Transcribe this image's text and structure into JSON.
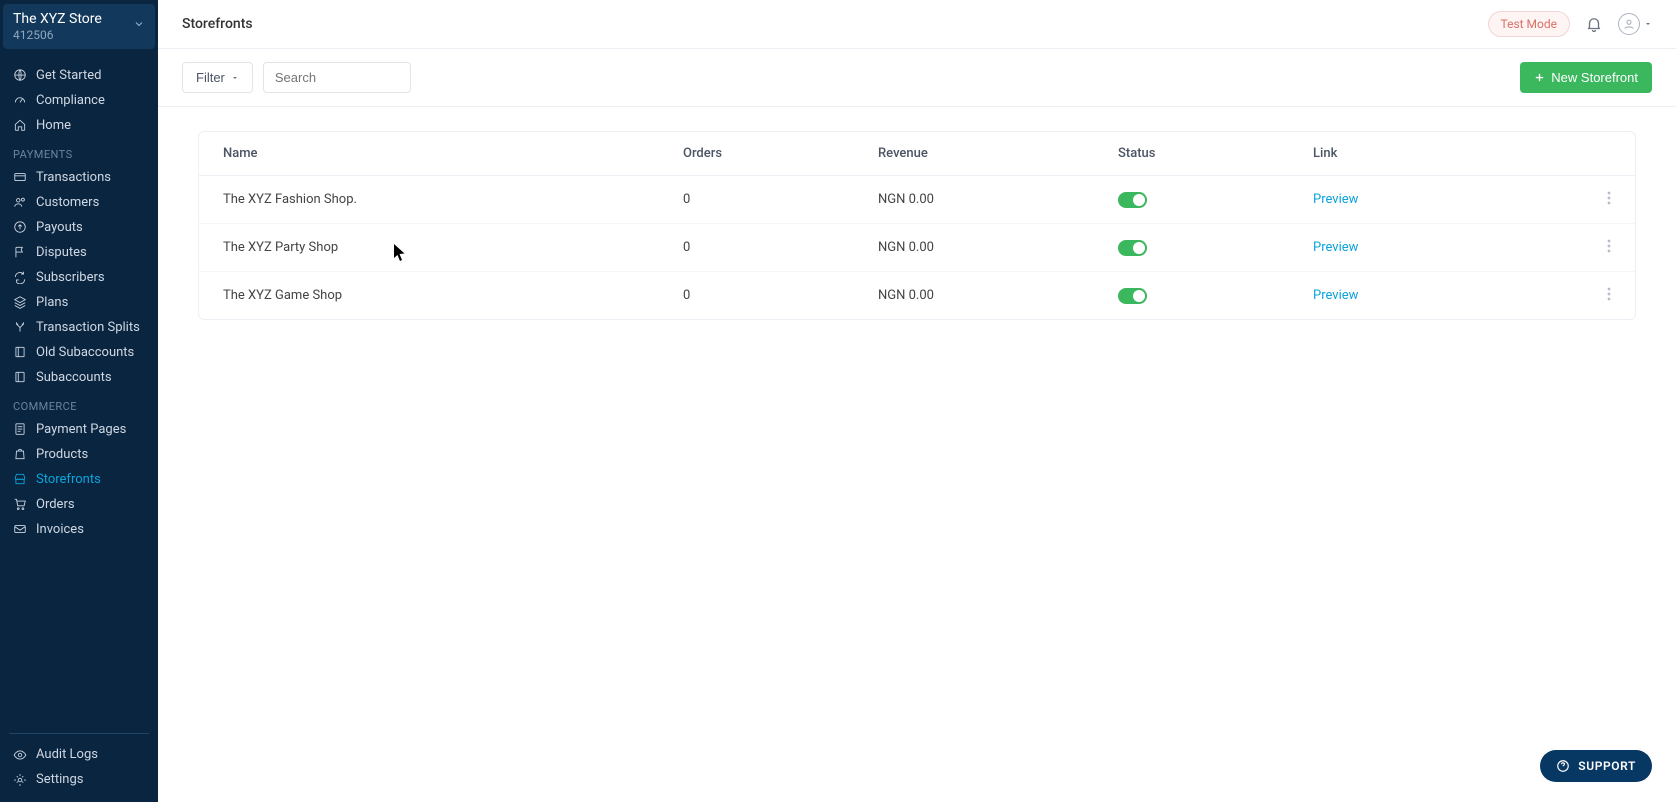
{
  "store": {
    "name": "The XYZ Store",
    "id": "412506"
  },
  "sidebar": {
    "top": [
      {
        "label": "Get Started",
        "icon": "globe"
      },
      {
        "label": "Compliance",
        "icon": "speed"
      },
      {
        "label": "Home",
        "icon": "home"
      }
    ],
    "sections": [
      {
        "title": "PAYMENTS",
        "items": [
          {
            "label": "Transactions",
            "icon": "card"
          },
          {
            "label": "Customers",
            "icon": "users"
          },
          {
            "label": "Payouts",
            "icon": "arrow-up-circle"
          },
          {
            "label": "Disputes",
            "icon": "flag"
          },
          {
            "label": "Subscribers",
            "icon": "refresh"
          },
          {
            "label": "Plans",
            "icon": "layers"
          },
          {
            "label": "Transaction Splits",
            "icon": "split"
          },
          {
            "label": "Old Subaccounts",
            "icon": "book"
          },
          {
            "label": "Subaccounts",
            "icon": "book"
          }
        ]
      },
      {
        "title": "COMMERCE",
        "items": [
          {
            "label": "Payment Pages",
            "icon": "page"
          },
          {
            "label": "Products",
            "icon": "bag"
          },
          {
            "label": "Storefronts",
            "icon": "store",
            "active": true
          },
          {
            "label": "Orders",
            "icon": "cart"
          },
          {
            "label": "Invoices",
            "icon": "mail"
          }
        ]
      }
    ],
    "bottom": [
      {
        "label": "Audit Logs",
        "icon": "eye"
      },
      {
        "label": "Settings",
        "icon": "gear"
      }
    ]
  },
  "header": {
    "title": "Storefronts",
    "test_mode": "Test Mode"
  },
  "toolbar": {
    "filter_label": "Filter",
    "search_placeholder": "Search",
    "new_label": "New Storefront"
  },
  "table": {
    "columns": {
      "name": "Name",
      "orders": "Orders",
      "revenue": "Revenue",
      "status": "Status",
      "link": "Link"
    },
    "preview_label": "Preview",
    "rows": [
      {
        "name": "The XYZ Fashion Shop.",
        "orders": "0",
        "revenue": "NGN 0.00",
        "status_on": true
      },
      {
        "name": "The XYZ Party Shop",
        "orders": "0",
        "revenue": "NGN 0.00",
        "status_on": true
      },
      {
        "name": "The XYZ Game Shop",
        "orders": "0",
        "revenue": "NGN 0.00",
        "status_on": true
      }
    ]
  },
  "support_label": "SUPPORT"
}
